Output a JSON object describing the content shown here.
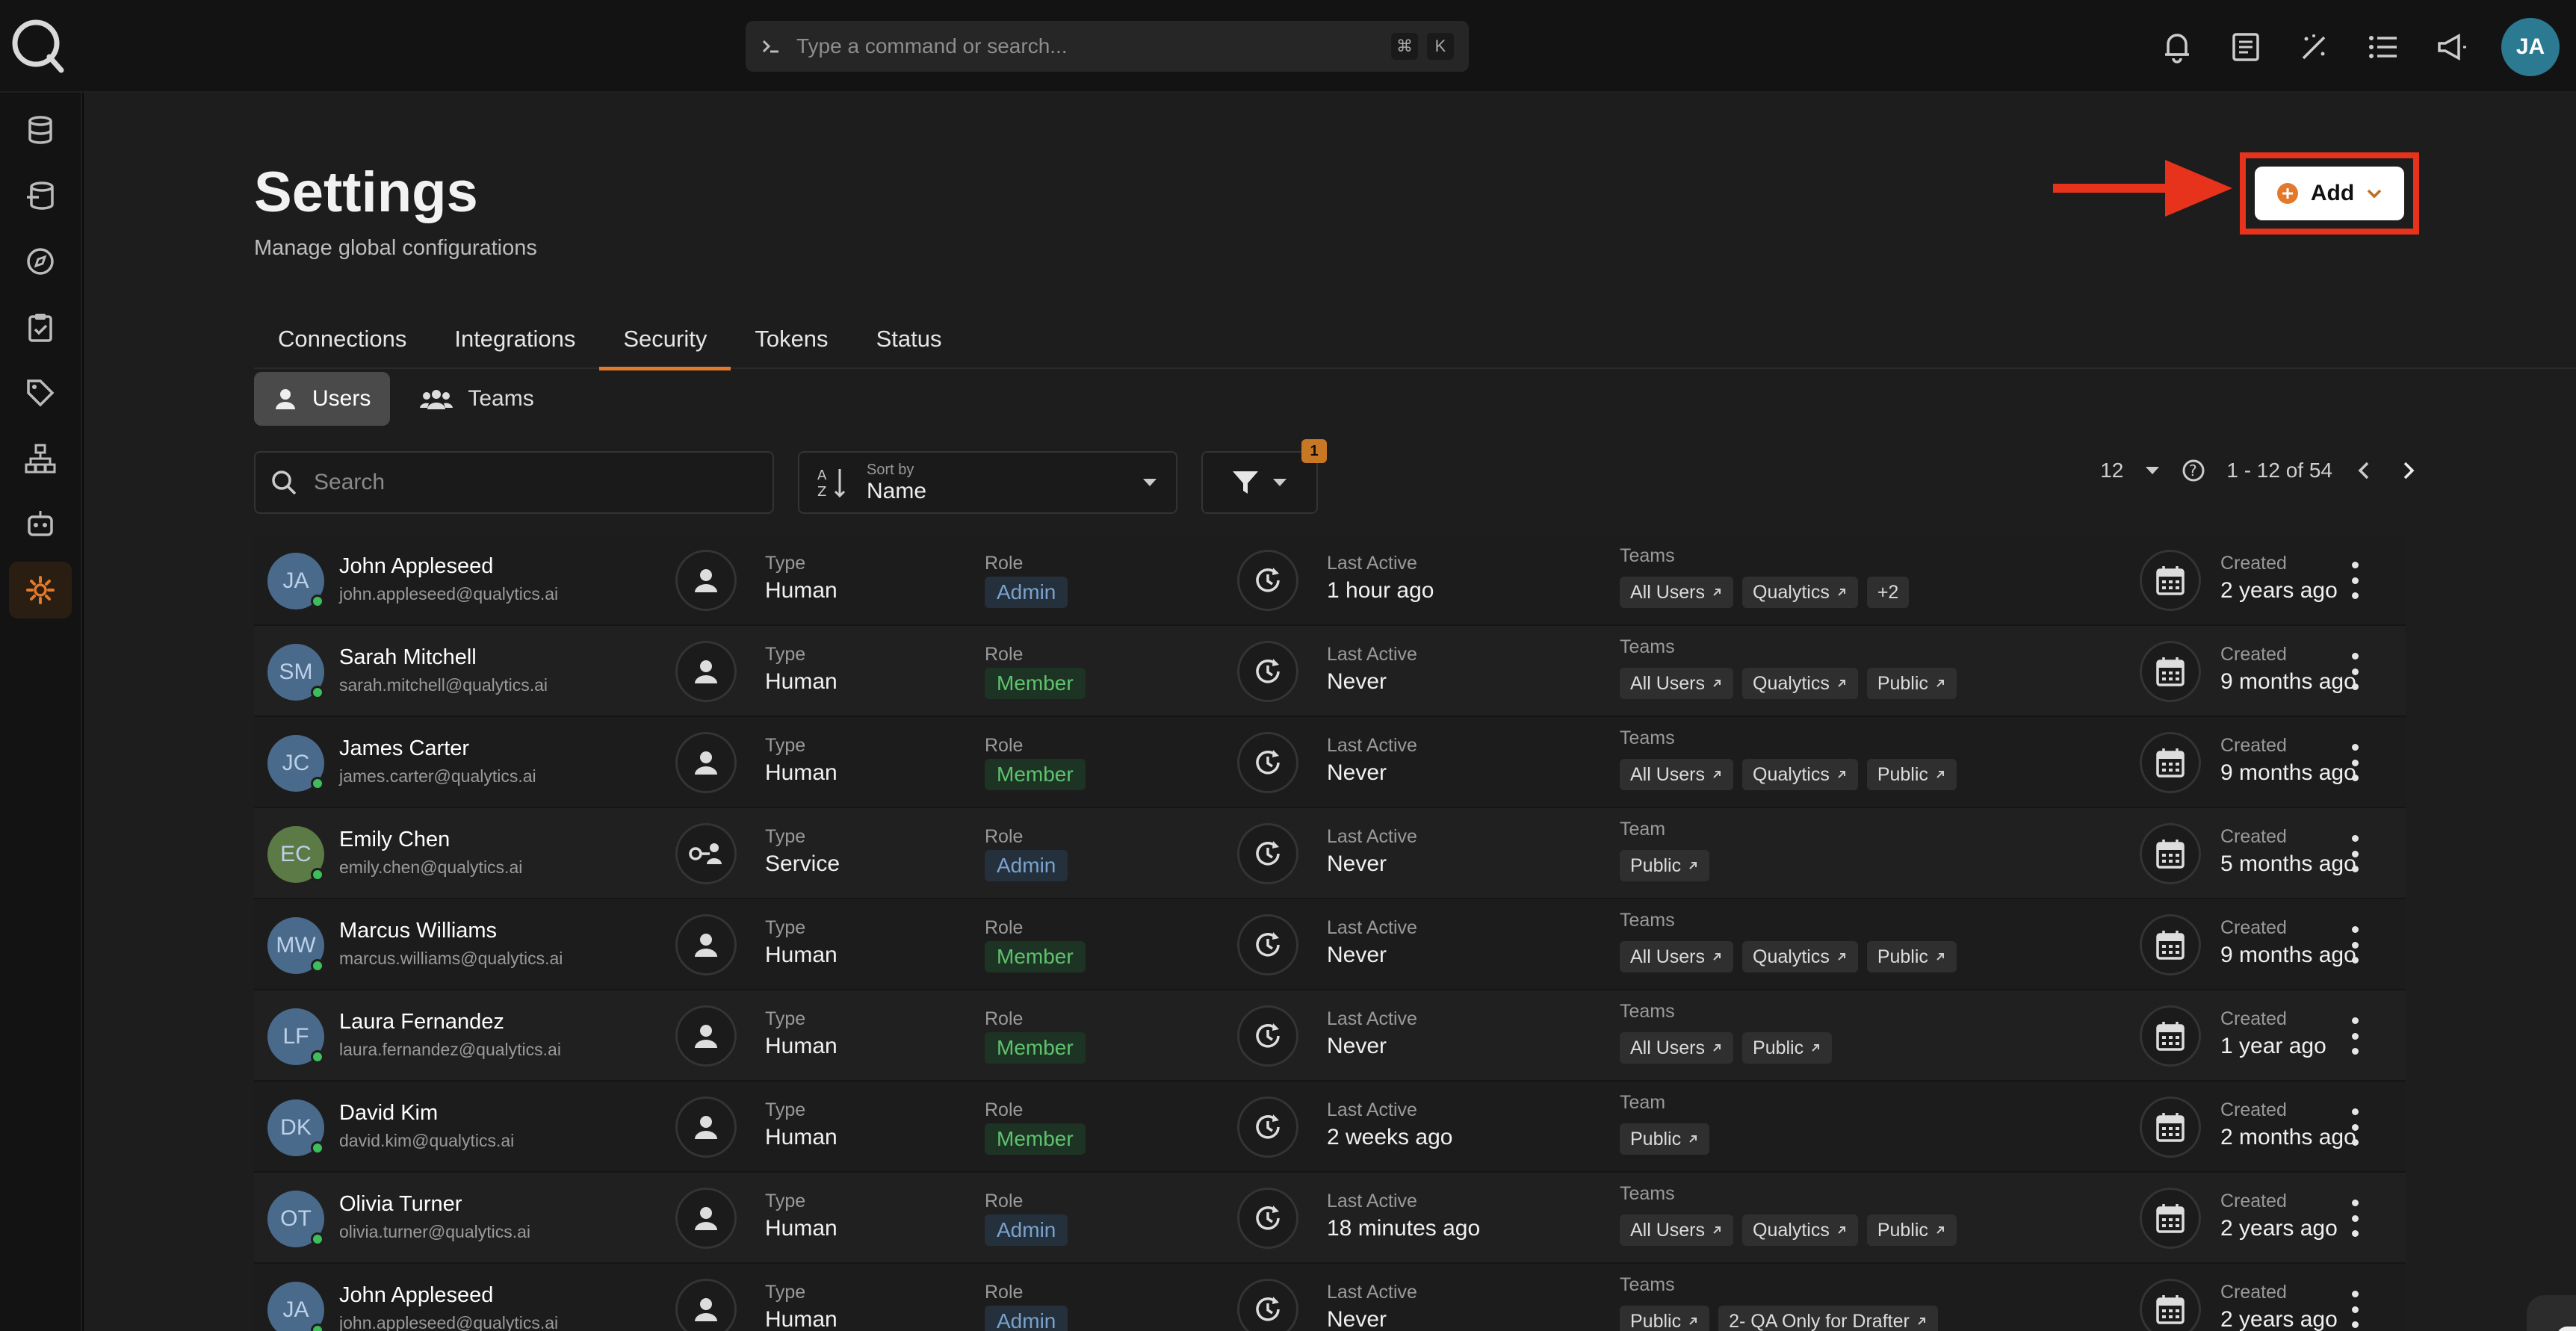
{
  "header": {
    "command_placeholder": "Type a command or search...",
    "kbd_cmd": "⌘",
    "kbd_k": "K",
    "user_initials": "JA"
  },
  "page": {
    "title": "Settings",
    "subtitle": "Manage global configurations",
    "add_label": "Add"
  },
  "tabs": [
    {
      "label": "Connections"
    },
    {
      "label": "Integrations"
    },
    {
      "label": "Security"
    },
    {
      "label": "Tokens"
    },
    {
      "label": "Status"
    }
  ],
  "subtabs": [
    {
      "label": "Users"
    },
    {
      "label": "Teams"
    }
  ],
  "toolbar": {
    "search_placeholder": "Search",
    "sort_label": "Sort by",
    "sort_value": "Name",
    "filter_count": "1",
    "page_size": "12",
    "range": "1 - 12 of 54"
  },
  "columns": {
    "type": "Type",
    "role": "Role",
    "last_active": "Last Active",
    "teams": "Teams",
    "team": "Team",
    "created": "Created"
  },
  "users": [
    {
      "initials": "JA",
      "name": "John Appleseed",
      "email": "john.appleseed@qualytics.ai",
      "type": "Human",
      "role": "Admin",
      "last_active": "1 hour ago",
      "teams_label": "Teams",
      "teams": [
        "All Users",
        "Qualytics"
      ],
      "more": "+2",
      "created": "2 years ago",
      "avatar_color": "#4a6a8c"
    },
    {
      "initials": "SM",
      "name": "Sarah Mitchell",
      "email": "sarah.mitchell@qualytics.ai",
      "type": "Human",
      "role": "Member",
      "last_active": "Never",
      "teams_label": "Teams",
      "teams": [
        "All Users",
        "Qualytics",
        "Public"
      ],
      "more": "",
      "created": "9 months ago",
      "avatar_color": "#4a6a8c"
    },
    {
      "initials": "JC",
      "name": "James Carter",
      "email": "james.carter@qualytics.ai",
      "type": "Human",
      "role": "Member",
      "last_active": "Never",
      "teams_label": "Teams",
      "teams": [
        "All Users",
        "Qualytics",
        "Public"
      ],
      "more": "",
      "created": "9 months ago",
      "avatar_color": "#4a6a8c"
    },
    {
      "initials": "EC",
      "name": "Emily Chen",
      "email": "emily.chen@qualytics.ai",
      "type": "Service",
      "role": "Admin",
      "last_active": "Never",
      "teams_label": "Team",
      "teams": [
        "Public"
      ],
      "more": "",
      "created": "5 months ago",
      "avatar_color": "#5b7a45"
    },
    {
      "initials": "MW",
      "name": "Marcus Williams",
      "email": "marcus.williams@qualytics.ai",
      "type": "Human",
      "role": "Member",
      "last_active": "Never",
      "teams_label": "Teams",
      "teams": [
        "All Users",
        "Qualytics",
        "Public"
      ],
      "more": "",
      "created": "9 months ago",
      "avatar_color": "#4a6a8c"
    },
    {
      "initials": "LF",
      "name": "Laura Fernandez",
      "email": "laura.fernandez@qualytics.ai",
      "type": "Human",
      "role": "Member",
      "last_active": "Never",
      "teams_label": "Teams",
      "teams": [
        "All Users",
        "Public"
      ],
      "more": "",
      "created": "1 year ago",
      "avatar_color": "#4a6a8c"
    },
    {
      "initials": "DK",
      "name": "David Kim",
      "email": "david.kim@qualytics.ai",
      "type": "Human",
      "role": "Member",
      "last_active": "2 weeks ago",
      "teams_label": "Team",
      "teams": [
        "Public"
      ],
      "more": "",
      "created": "2 months ago",
      "avatar_color": "#4a6a8c"
    },
    {
      "initials": "OT",
      "name": "Olivia Turner",
      "email": "olivia.turner@qualytics.ai",
      "type": "Human",
      "role": "Admin",
      "last_active": "18 minutes ago",
      "teams_label": "Teams",
      "teams": [
        "All Users",
        "Qualytics",
        "Public"
      ],
      "more": "",
      "created": "2 years ago",
      "avatar_color": "#4a6a8c"
    },
    {
      "initials": "JA",
      "name": "John Appleseed",
      "email": "john.appleseed@qualytics.ai",
      "type": "Human",
      "role": "Admin",
      "last_active": "Never",
      "teams_label": "Teams",
      "teams": [
        "Public",
        "2- QA Only for Drafter"
      ],
      "more": "",
      "created": "2 years ago",
      "avatar_color": "#4a6a8c"
    }
  ],
  "colors": {
    "accent": "#e37a2b",
    "highlight": "#e7331b"
  }
}
